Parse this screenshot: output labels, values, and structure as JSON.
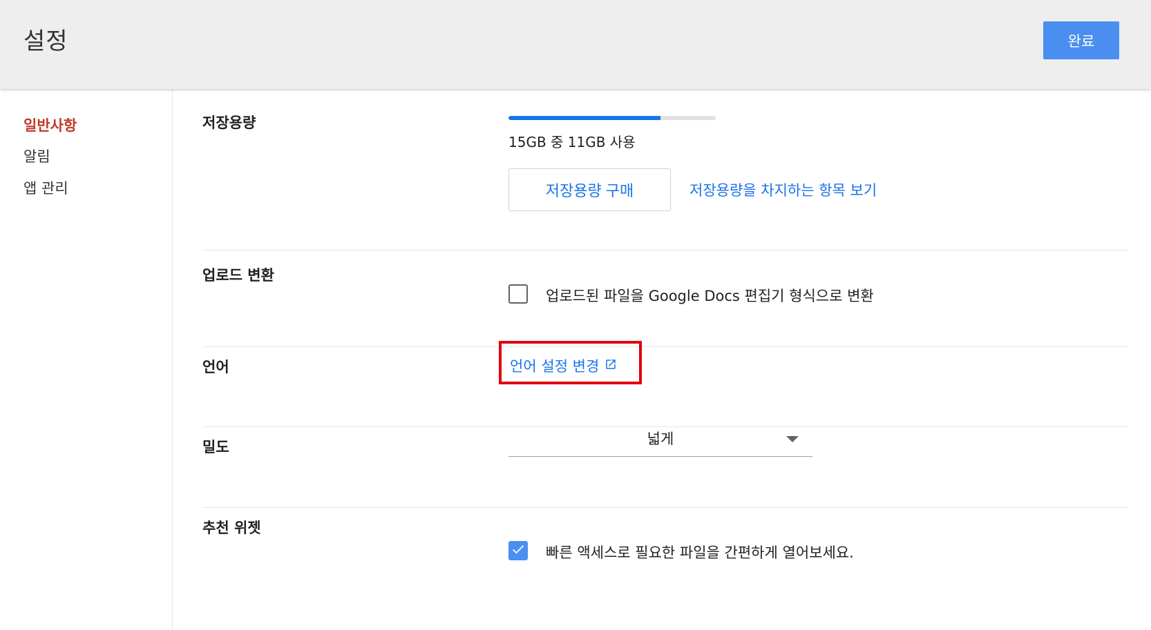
{
  "header": {
    "title": "설정",
    "done_label": "완료"
  },
  "sidebar": {
    "items": [
      {
        "label": "일반사항",
        "active": true
      },
      {
        "label": "알림",
        "active": false
      },
      {
        "label": "앱 관리",
        "active": false
      }
    ]
  },
  "storage": {
    "label": "저장용량",
    "used_fraction": 0.733,
    "usage_text": "15GB 중 11GB 사용",
    "buy_button": "저장용량 구매",
    "view_link": "저장용량을 차지하는 항목 보기",
    "bar_color": "#1a73e8"
  },
  "upload_convert": {
    "label": "업로드 변환",
    "checkbox_label": "업로드된 파일을 Google Docs 편집기 형식으로 변환",
    "checked": false
  },
  "language": {
    "label": "언어",
    "link": "언어 설정 변경",
    "icon": "external-link-icon"
  },
  "density": {
    "label": "밀도",
    "value": "넓게"
  },
  "suggestions_widget": {
    "label": "추천 위젯",
    "checkbox_label": "빠른 액세스로 필요한 파일을 간편하게 열어보세요.",
    "checked": true
  },
  "colors": {
    "accent": "#4a8ff0",
    "link": "#1a73e8",
    "active_nav": "#c0392b",
    "highlight": "#e0000f"
  }
}
